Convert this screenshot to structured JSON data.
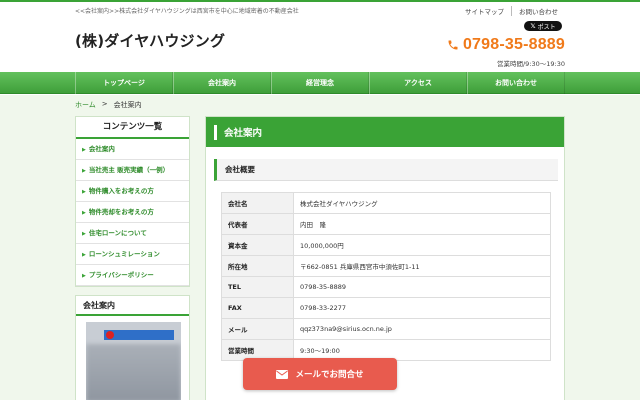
{
  "header": {
    "tagline": "<<会社案内>>株式会社ダイヤハウジングは西宮市を中心に地域密着の不動産会社",
    "toplinks": [
      "サイトマップ",
      "お問い合わせ"
    ],
    "x_post_label": "ポスト",
    "logo": "(株)ダイヤハウジング",
    "phone": "0798-35-8889",
    "hours": "営業時間/9:30～19:30"
  },
  "nav": [
    "トップページ",
    "会社案内",
    "経営理念",
    "アクセス",
    "お問い合わせ"
  ],
  "breadcrumb": {
    "home": "ホーム",
    "separator": ">",
    "current": "会社案内"
  },
  "sidebar": {
    "title": "コンテンツ一覧",
    "items": [
      "会社案内",
      "当社売主 販売実績（一例）",
      "物件購入をお考えの方",
      "物件売却をお考えの方",
      "住宅ローンについて",
      "ローンシュミレーション",
      "プライバシーポリシー"
    ]
  },
  "company_box": {
    "title": "会社案内",
    "sign_text": "ダイヤハウジング"
  },
  "main": {
    "title": "会社案内",
    "section_title": "会社概要",
    "rows": [
      {
        "label": "会社名",
        "value": "株式会社ダイヤハウジング"
      },
      {
        "label": "代表者",
        "value": "内田　隆"
      },
      {
        "label": "資本金",
        "value": "10,000,000円"
      },
      {
        "label": "所在地",
        "value": "〒662-0851 兵庫県西宮市中須佐町1-11"
      },
      {
        "label": "TEL",
        "value": "0798-35-8889"
      },
      {
        "label": "FAX",
        "value": "0798-33-2277"
      },
      {
        "label": "メール",
        "value": "qqz373na9@sirius.ocn.ne.jp"
      },
      {
        "label": "営業時間",
        "value": "9:30～19:00"
      }
    ]
  },
  "float_button": {
    "label": "メールでお問合せ"
  },
  "colors": {
    "brand_green": "#3aa336",
    "phone_orange": "#f07a1a",
    "cta_red": "#e85b4e"
  }
}
